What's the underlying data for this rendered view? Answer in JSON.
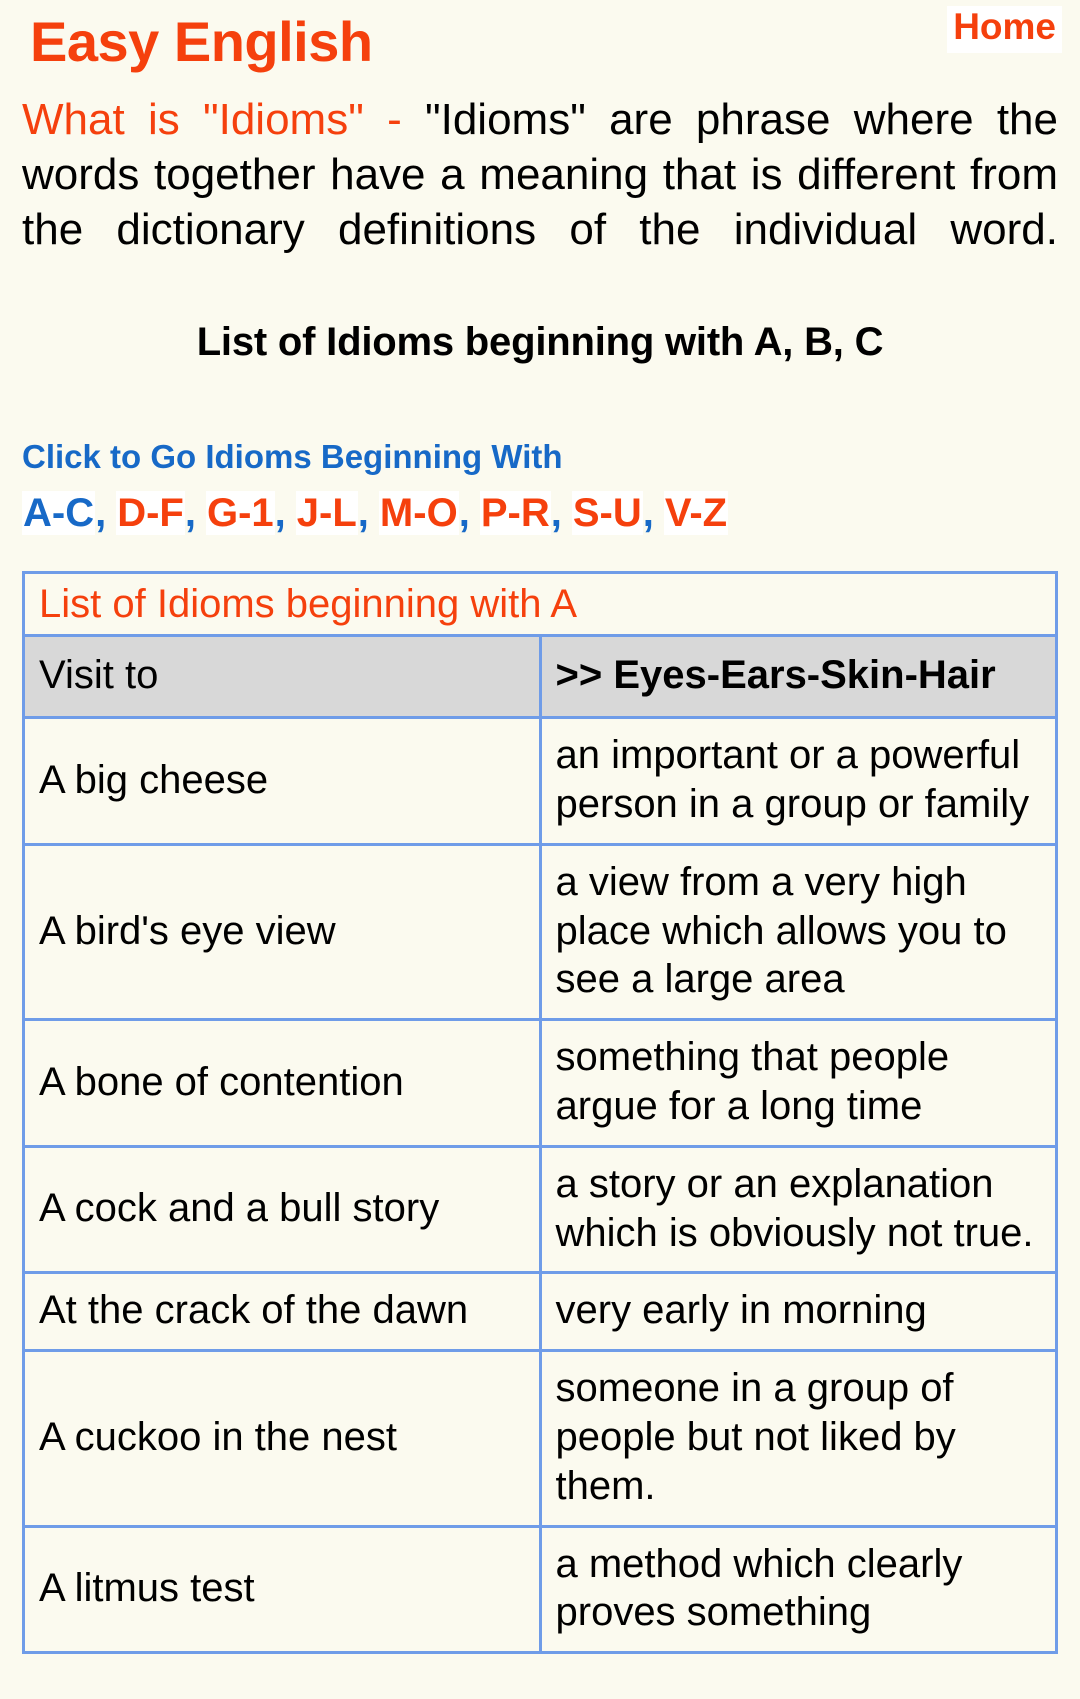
{
  "header": {
    "brand": "Easy English",
    "home_label": "Home"
  },
  "intro": {
    "highlight": "What is \"Idioms\" -",
    "body": " \"Idioms\" are phrase where the words together have a meaning that is different from the dictionary definitions of the individual word.",
    "subtitle": "List of Idioms beginning with A, B, C"
  },
  "nav": {
    "title": "Click to Go Idioms Beginning With",
    "separator": ",",
    "links": [
      {
        "label": "A-C",
        "current": true
      },
      {
        "label": "D-F",
        "current": false
      },
      {
        "label": "G-1",
        "current": false
      },
      {
        "label": "J-L",
        "current": false
      },
      {
        "label": "M-O",
        "current": false
      },
      {
        "label": "P-R",
        "current": false
      },
      {
        "label": "S-U",
        "current": false
      },
      {
        "label": "V-Z",
        "current": false
      }
    ]
  },
  "table": {
    "caption": "List of Idioms beginning with A",
    "head": {
      "visit_label": "Visit to",
      "visit_target": ">> Eyes-Ears-Skin-Hair"
    },
    "rows": [
      {
        "term": "A big cheese",
        "definition": "an important or a powerful person in a group or family"
      },
      {
        "term": "A bird's eye view",
        "definition": "a view from a very high place which allows you to see a large area"
      },
      {
        "term": "A bone of contention",
        "definition": "something that people argue for a long time"
      },
      {
        "term": "A cock and a bull story",
        "definition": "a story or an explanation which is obviously not true."
      },
      {
        "term": "At the crack of the dawn",
        "definition": "very early in morning"
      },
      {
        "term": "A cuckoo in the nest",
        "definition": "someone in a group of people but not liked by them."
      },
      {
        "term": "A litmus test",
        "definition": "a method which clearly proves something"
      }
    ]
  },
  "colors": {
    "page_background": "#fbfaef",
    "accent_orange": "#f5400d",
    "accent_blue": "#1769c7",
    "table_border": "#6f9ce8",
    "head_row_background": "#d8d8d8",
    "text": "#000000"
  }
}
